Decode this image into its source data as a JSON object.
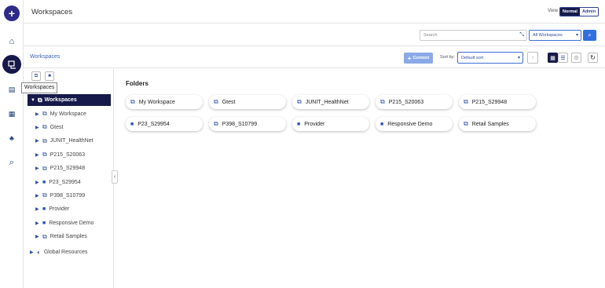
{
  "header": {
    "title": "Workspaces",
    "view_label": "View",
    "view_normal": "Normal",
    "view_admin": "Admin"
  },
  "rail": {
    "tooltip": "Workspaces"
  },
  "search": {
    "placeholder": "Search",
    "scope": "All Workspaces"
  },
  "toolbar": {
    "breadcrumb": "Workspaces",
    "content_label": "Content",
    "sort_label": "Sort by:",
    "sort_value": "Default sort"
  },
  "tree": {
    "root": "Workspaces",
    "items": [
      {
        "label": "My Workspace",
        "icon": "workspace"
      },
      {
        "label": "Gtest",
        "icon": "workspace"
      },
      {
        "label": "JUNIT_HealthNet",
        "icon": "workspace"
      },
      {
        "label": "P215_S20063",
        "icon": "workspace"
      },
      {
        "label": "P215_S29948",
        "icon": "workspace"
      },
      {
        "label": "P23_S29954",
        "icon": "folder"
      },
      {
        "label": "P398_S10799",
        "icon": "workspace"
      },
      {
        "label": "Provider",
        "icon": "folder"
      },
      {
        "label": "Responsive Demo",
        "icon": "folder"
      },
      {
        "label": "Retail Samples",
        "icon": "workspace"
      }
    ],
    "global": "Global Resources"
  },
  "main": {
    "folders_title": "Folders",
    "cards": [
      {
        "label": "My Workspace",
        "icon": "workspace"
      },
      {
        "label": "Gtest",
        "icon": "workspace"
      },
      {
        "label": "JUNIT_HealthNet",
        "icon": "workspace"
      },
      {
        "label": "P215_S20063",
        "icon": "workspace"
      },
      {
        "label": "P215_S29948",
        "icon": "workspace"
      },
      {
        "label": "P23_S29954",
        "icon": "folder"
      },
      {
        "label": "P398_S10799",
        "icon": "workspace"
      },
      {
        "label": "Provider",
        "icon": "folder"
      },
      {
        "label": "Responsive Demo",
        "icon": "folder"
      },
      {
        "label": "Retail Samples",
        "icon": "workspace"
      }
    ]
  },
  "colors": {
    "brand_dark": "#161a4a",
    "accent": "#2f6fe0",
    "folder_blue": "#2a4fb0"
  }
}
